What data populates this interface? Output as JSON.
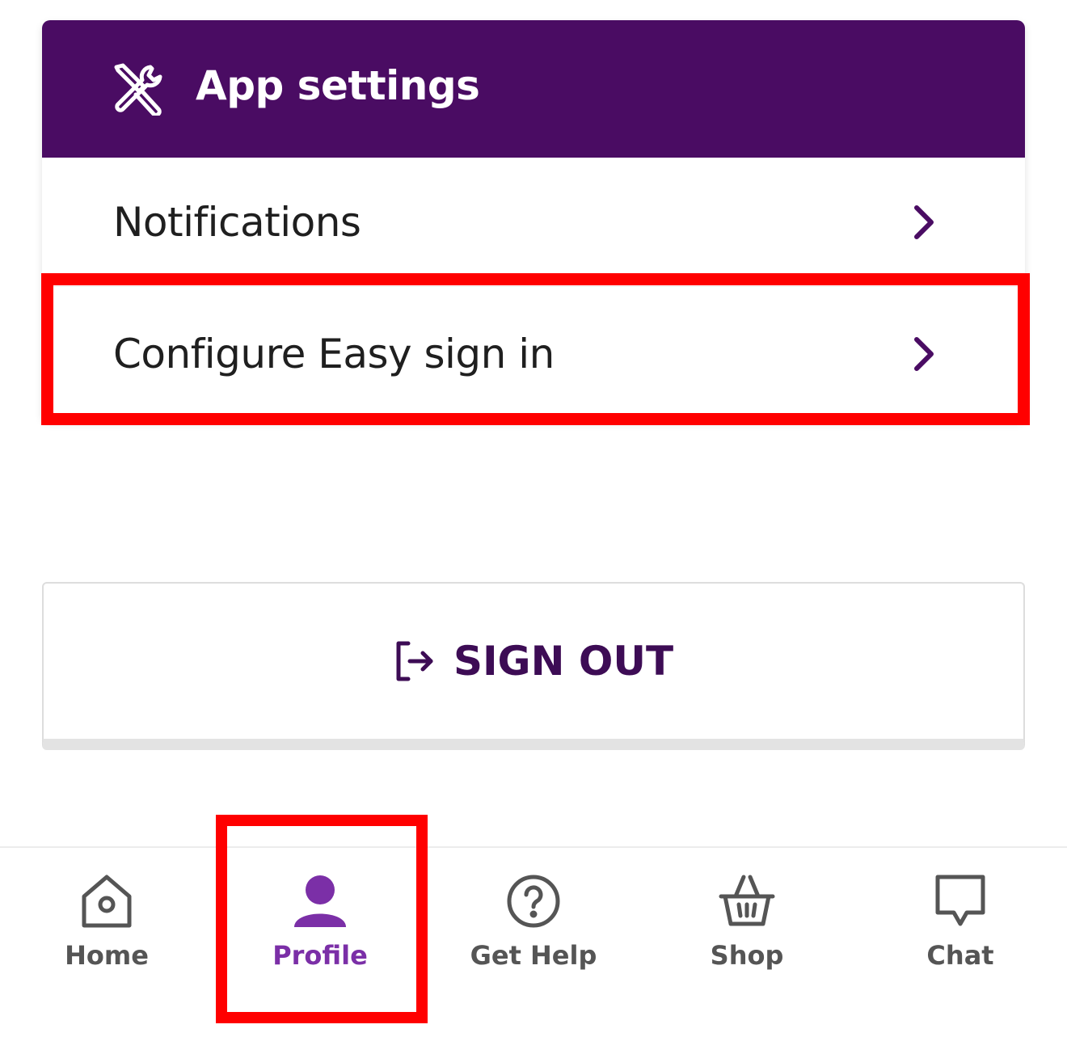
{
  "colors": {
    "header_bg": "#4a0c63",
    "accent": "#7b2fa7",
    "chevron": "#4a0c63",
    "signout_text": "#3d0c55",
    "highlight": "#ff0000",
    "nav_inactive": "#555555"
  },
  "settings_card": {
    "title": "App settings",
    "title_icon": "tools-icon",
    "rows": [
      {
        "label": "Notifications",
        "icon": "chevron-right-icon"
      },
      {
        "label": "Configure Easy sign in",
        "icon": "chevron-right-icon"
      }
    ]
  },
  "sign_out": {
    "label": "SIGN OUT",
    "icon": "sign-out-icon"
  },
  "bottom_nav": {
    "active": "Profile",
    "items": [
      {
        "label": "Home",
        "icon": "home-icon"
      },
      {
        "label": "Profile",
        "icon": "profile-icon"
      },
      {
        "label": "Get Help",
        "icon": "help-icon"
      },
      {
        "label": "Shop",
        "icon": "basket-icon"
      },
      {
        "label": "Chat",
        "icon": "chat-icon"
      }
    ]
  }
}
